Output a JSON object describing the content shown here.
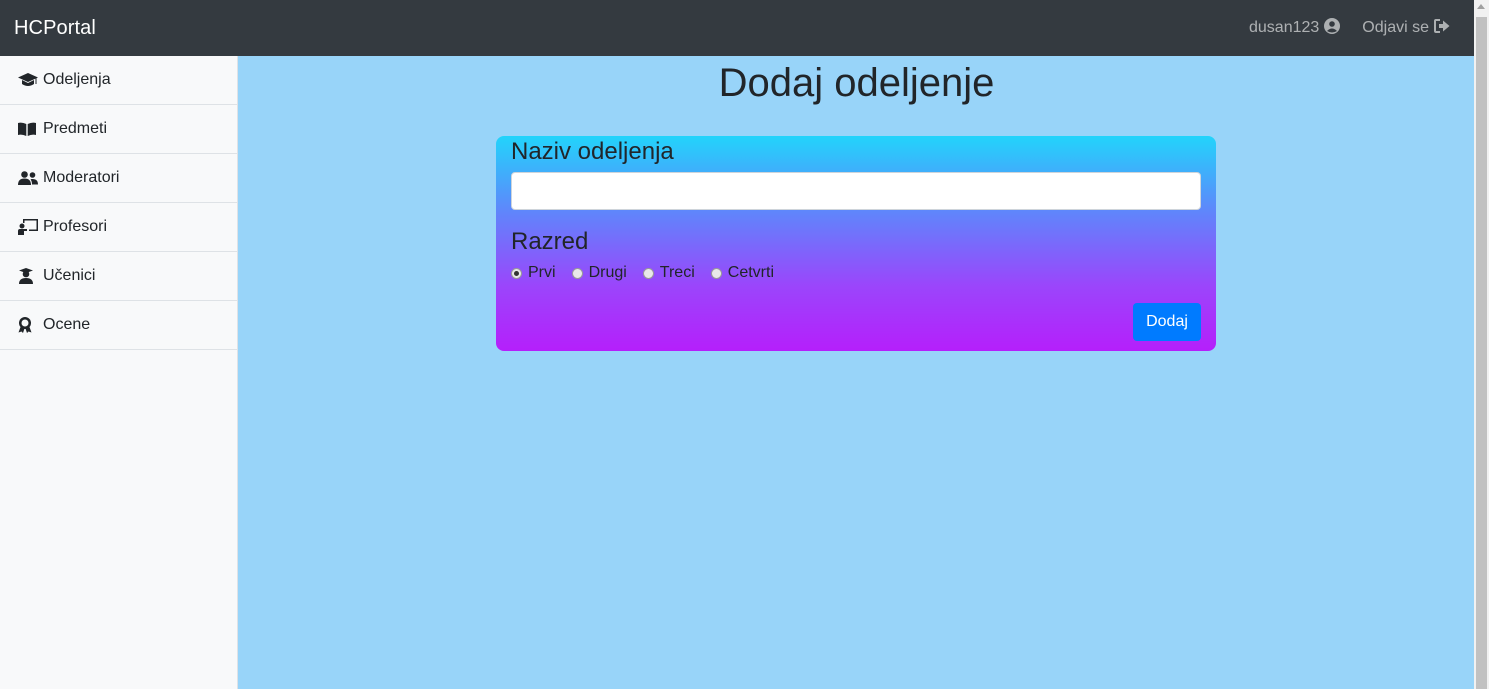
{
  "navbar": {
    "brand": "HCPortal",
    "username": "dusan123",
    "logout_label": "Odjavi se"
  },
  "sidebar": {
    "items": [
      {
        "label": "Odeljenja",
        "icon": "graduation-cap-icon"
      },
      {
        "label": "Predmeti",
        "icon": "book-open-icon"
      },
      {
        "label": "Moderatori",
        "icon": "users-icon"
      },
      {
        "label": "Profesori",
        "icon": "chalkboard-teacher-icon"
      },
      {
        "label": "Učenici",
        "icon": "user-graduate-icon"
      },
      {
        "label": "Ocene",
        "icon": "award-icon"
      }
    ]
  },
  "main": {
    "title": "Dodaj odeljenje",
    "form": {
      "name_label": "Naziv odeljenja",
      "name_value": "",
      "grade_label": "Razred",
      "grade_options": [
        "Prvi",
        "Drugi",
        "Treci",
        "Cetvrti"
      ],
      "grade_selected": "Prvi",
      "submit_label": "Dodaj"
    }
  },
  "colors": {
    "navbar_bg": "#343a40",
    "page_bg": "#98d4f9",
    "sidebar_bg": "#f8f9fa",
    "gradient_top": "#22d4fb",
    "gradient_bottom": "#b51ffb",
    "primary_button": "#007bff"
  }
}
